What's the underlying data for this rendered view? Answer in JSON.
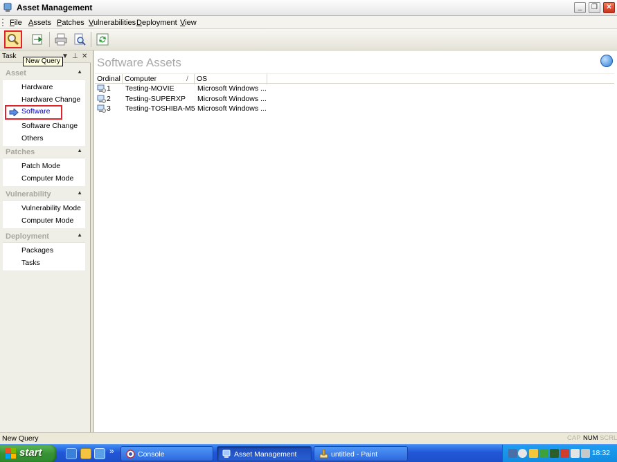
{
  "window": {
    "title": "Asset Management"
  },
  "menu": {
    "items": [
      {
        "label": "File",
        "u": "F",
        "rest": "ile"
      },
      {
        "label": "Assets",
        "u": "A",
        "rest": "ssets"
      },
      {
        "label": "Patches",
        "u": "P",
        "rest": "atches"
      },
      {
        "label": "Vulnerabilities",
        "u": "V",
        "rest": "ulnerabilities"
      },
      {
        "label": "Deployment",
        "u": "D",
        "rest": "eployment"
      },
      {
        "label": "View",
        "u": "V",
        "rest": "iew"
      }
    ]
  },
  "toolbar": {
    "tooltip": "New Query",
    "buttons": [
      "new-query",
      "export",
      "print",
      "print-preview",
      "refresh"
    ]
  },
  "taskpane": {
    "header": "Task",
    "groups": [
      {
        "title": "Asset",
        "items": [
          "Hardware",
          "Hardware Change",
          "Software",
          "Software Change",
          "Others"
        ]
      },
      {
        "title": "Patches",
        "items": [
          "Patch Mode",
          "Computer Mode"
        ]
      },
      {
        "title": "Vulnerability",
        "items": [
          "Vulnerability Mode",
          "Computer Mode"
        ]
      },
      {
        "title": "Deployment",
        "items": [
          "Packages",
          "Tasks"
        ]
      }
    ],
    "selected": "Software"
  },
  "main": {
    "title": "Software Assets",
    "columns": [
      "Ordinal",
      "Computer",
      "OS"
    ],
    "sort_indicator": "/",
    "rows": [
      {
        "ordinal": "1",
        "computer": "Testing-MOVIE",
        "os": "Microsoft Windows ..."
      },
      {
        "ordinal": "2",
        "computer": "Testing-SUPERXP",
        "os": "Microsoft Windows ..."
      },
      {
        "ordinal": "3",
        "computer": "Testing-TOSHIBA-M5",
        "os": "Microsoft Windows ..."
      }
    ]
  },
  "statusbar": {
    "text": "New Query",
    "indicators": {
      "cap": "CAP",
      "num": "NUM",
      "scrl": "SCRL"
    }
  },
  "taskbar": {
    "start": "start",
    "buttons": [
      "Console",
      "Asset Management",
      "untitled - Paint"
    ],
    "overflow": "»",
    "clock": "18:32"
  },
  "colors": {
    "selection_outline": "#e0222a",
    "taskbar_blue": "#2157d7",
    "start_green": "#379234"
  }
}
